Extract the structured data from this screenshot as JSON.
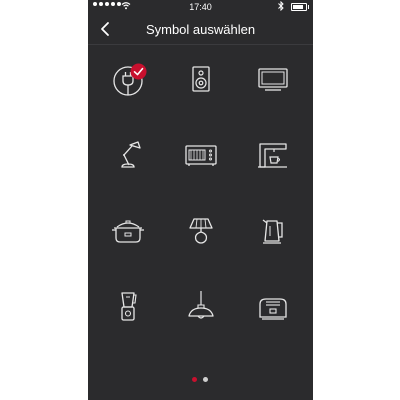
{
  "status_bar": {
    "time": "17:40"
  },
  "header": {
    "title": "Symbol auswählen"
  },
  "icons": [
    {
      "name": "plug-icon",
      "selected": true
    },
    {
      "name": "speaker-icon",
      "selected": false
    },
    {
      "name": "tv-icon",
      "selected": false
    },
    {
      "name": "desk-lamp-icon",
      "selected": false
    },
    {
      "name": "microwave-icon",
      "selected": false
    },
    {
      "name": "coffee-machine-icon",
      "selected": false
    },
    {
      "name": "rice-cooker-icon",
      "selected": false
    },
    {
      "name": "table-lamp-icon",
      "selected": false
    },
    {
      "name": "kettle-icon",
      "selected": false
    },
    {
      "name": "blender-icon",
      "selected": false
    },
    {
      "name": "pendant-lamp-icon",
      "selected": false
    },
    {
      "name": "toaster-icon",
      "selected": false
    }
  ],
  "pager": {
    "page_count": 2,
    "active_page": 1
  },
  "colors": {
    "background": "#2b2b2d",
    "icon_stroke": "#e6e6e6",
    "accent": "#c8102e",
    "pager_inactive": "#cfcfcf"
  }
}
